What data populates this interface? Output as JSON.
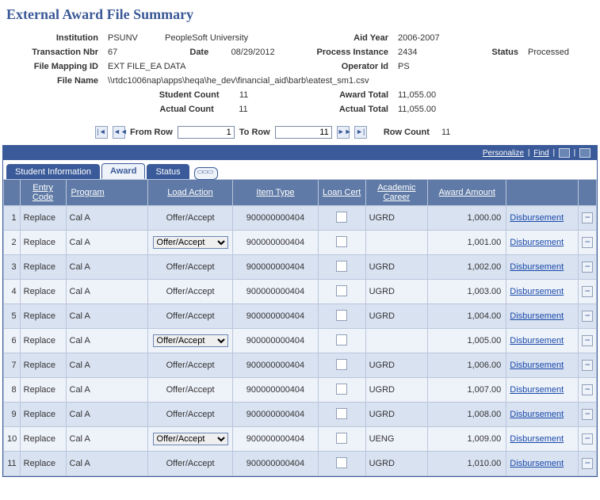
{
  "title": "External Award File Summary",
  "summary": {
    "institution_label": "Institution",
    "institution_code": "PSUNV",
    "institution_name": "PeopleSoft University",
    "aid_year_label": "Aid Year",
    "aid_year": "2006-2007",
    "transaction_nbr_label": "Transaction Nbr",
    "transaction_nbr": "67",
    "date_label": "Date",
    "date": "08/29/2012",
    "process_instance_label": "Process Instance",
    "process_instance": "2434",
    "status_label": "Status",
    "status": "Processed",
    "file_mapping_id_label": "File Mapping ID",
    "file_mapping_id": "EXT FILE_EA DATA",
    "operator_id_label": "Operator Id",
    "operator_id": "PS",
    "file_name_label": "File Name",
    "file_name": "\\\\rtdc1006nap\\apps\\heqa\\he_dev\\financial_aid\\barb\\eatest_sm1.csv",
    "student_count_label": "Student Count",
    "student_count": "11",
    "award_total_label": "Award Total",
    "award_total": "11,055.00",
    "actual_count_label": "Actual Count",
    "actual_count": "11",
    "actual_total_label": "Actual Total",
    "actual_total": "11,055.00"
  },
  "nav": {
    "from_row_label": "From Row",
    "from_row": "1",
    "to_row_label": "To Row",
    "to_row": "11",
    "row_count_label": "Row Count",
    "row_count": "11"
  },
  "grid": {
    "personalize": "Personalize",
    "find": "Find",
    "tabs": {
      "student_info": "Student Information",
      "award": "Award",
      "status": "Status"
    },
    "headers": {
      "entry_code": "Entry Code",
      "program": "Program",
      "load_action": "Load Action",
      "item_type": "Item Type",
      "loan_cert": "Loan Cert",
      "academic_career": "Academic Career",
      "award_amount": "Award Amount"
    },
    "disbursement_label": "Disbursement",
    "rows": [
      {
        "n": "1",
        "entry": "Replace",
        "program": "Cal A",
        "load_text": "Offer/Accept",
        "load_select": false,
        "item": "900000000404",
        "career": "UGRD",
        "amount": "1,000.00"
      },
      {
        "n": "2",
        "entry": "Replace",
        "program": "Cal A",
        "load_text": "Offer/Accept",
        "load_select": true,
        "item": "900000000404",
        "career": "",
        "amount": "1,001.00"
      },
      {
        "n": "3",
        "entry": "Replace",
        "program": "Cal A",
        "load_text": "Offer/Accept",
        "load_select": false,
        "item": "900000000404",
        "career": "UGRD",
        "amount": "1,002.00"
      },
      {
        "n": "4",
        "entry": "Replace",
        "program": "Cal A",
        "load_text": "Offer/Accept",
        "load_select": false,
        "item": "900000000404",
        "career": "UGRD",
        "amount": "1,003.00"
      },
      {
        "n": "5",
        "entry": "Replace",
        "program": "Cal A",
        "load_text": "Offer/Accept",
        "load_select": false,
        "item": "900000000404",
        "career": "UGRD",
        "amount": "1,004.00"
      },
      {
        "n": "6",
        "entry": "Replace",
        "program": "Cal A",
        "load_text": "Offer/Accept",
        "load_select": true,
        "item": "900000000404",
        "career": "",
        "amount": "1,005.00"
      },
      {
        "n": "7",
        "entry": "Replace",
        "program": "Cal A",
        "load_text": "Offer/Accept",
        "load_select": false,
        "item": "900000000404",
        "career": "UGRD",
        "amount": "1,006.00"
      },
      {
        "n": "8",
        "entry": "Replace",
        "program": "Cal A",
        "load_text": "Offer/Accept",
        "load_select": false,
        "item": "900000000404",
        "career": "UGRD",
        "amount": "1,007.00"
      },
      {
        "n": "9",
        "entry": "Replace",
        "program": "Cal A",
        "load_text": "Offer/Accept",
        "load_select": false,
        "item": "900000000404",
        "career": "UGRD",
        "amount": "1,008.00"
      },
      {
        "n": "10",
        "entry": "Replace",
        "program": "Cal A",
        "load_text": "Offer/Accept",
        "load_select": true,
        "item": "900000000404",
        "career": "UENG",
        "amount": "1,009.00"
      },
      {
        "n": "11",
        "entry": "Replace",
        "program": "Cal A",
        "load_text": "Offer/Accept",
        "load_select": false,
        "item": "900000000404",
        "career": "UGRD",
        "amount": "1,010.00"
      }
    ]
  }
}
